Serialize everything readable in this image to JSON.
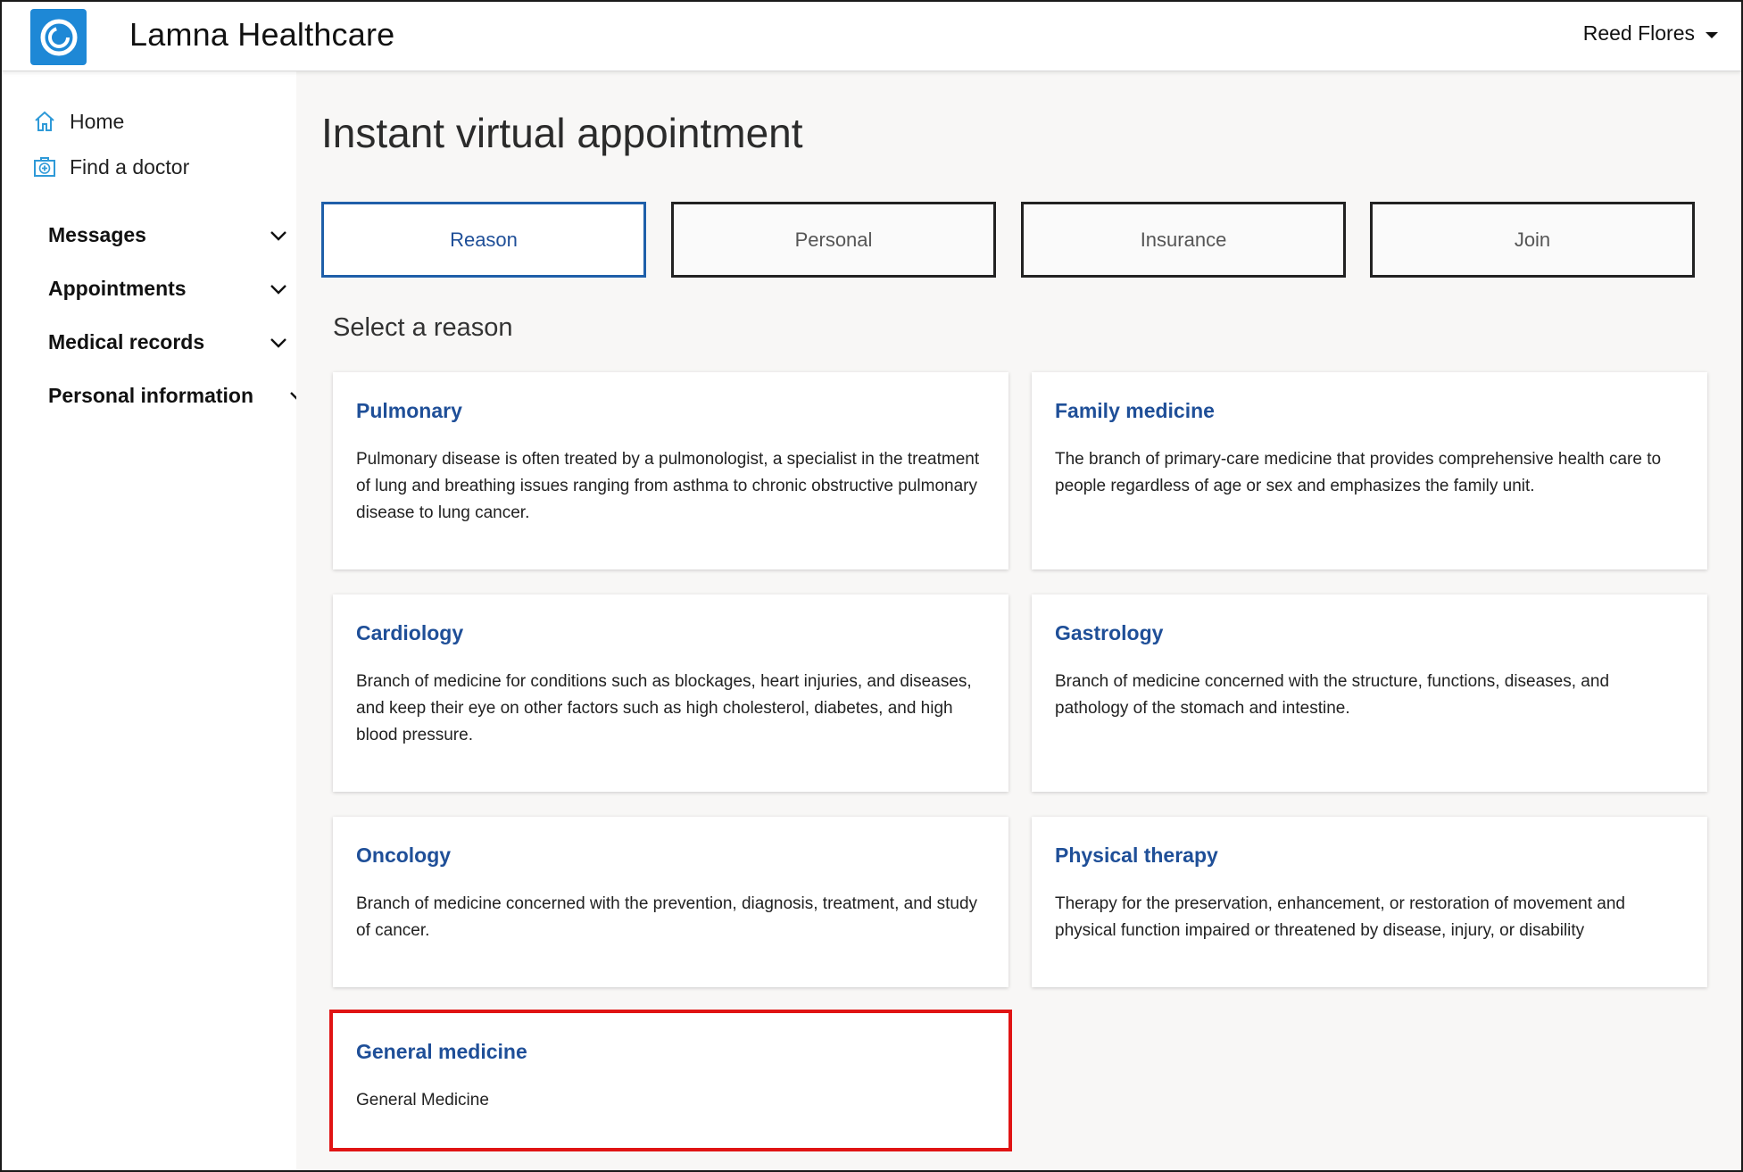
{
  "header": {
    "app_title": "Lamna Healthcare",
    "user_name": "Reed Flores",
    "logo_icon": "ring-logo-icon"
  },
  "sidebar": {
    "links": [
      {
        "label": "Home",
        "icon": "home-icon"
      },
      {
        "label": "Find a doctor",
        "icon": "medical-kit-icon"
      }
    ],
    "groups": [
      {
        "label": "Messages"
      },
      {
        "label": "Appointments"
      },
      {
        "label": "Medical records"
      },
      {
        "label": "Personal information"
      }
    ]
  },
  "main": {
    "page_title": "Instant virtual appointment",
    "steps": [
      {
        "label": "Reason",
        "active": true
      },
      {
        "label": "Personal",
        "active": false
      },
      {
        "label": "Insurance",
        "active": false
      },
      {
        "label": "Join",
        "active": false
      }
    ],
    "section_title": "Select a reason",
    "reasons": [
      {
        "title": "Pulmonary",
        "description": "Pulmonary disease is often treated by a pulmonologist, a specialist in the treatment of lung and breathing issues ranging from asthma to chronic obstructive pulmonary disease to lung cancer."
      },
      {
        "title": "Family medicine",
        "description": "The branch of primary-care medicine that provides comprehensive health care to people regardless of age or sex and emphasizes the family unit."
      },
      {
        "title": "Cardiology",
        "description": "Branch of medicine for conditions such as blockages, heart injuries, and diseases, and keep their eye on other factors such as high cholesterol, diabetes, and high blood pressure."
      },
      {
        "title": "Gastrology",
        "description": "Branch of medicine concerned with the structure, functions, diseases, and pathology of the stomach and intestine."
      },
      {
        "title": "Oncology",
        "description": "Branch of medicine concerned with the prevention, diagnosis, treatment, and study of cancer."
      },
      {
        "title": "Physical therapy",
        "description": "Therapy for the preservation, enhancement, or restoration of movement and physical function impaired or threatened by disease, injury, or disability"
      },
      {
        "title": "General medicine",
        "description": "General Medicine",
        "highlighted": true
      }
    ]
  },
  "colors": {
    "accent": "#1f4f98",
    "active_tab_border": "#1f5fa9",
    "logo_bg": "#1e88d6",
    "highlight": "#e01414",
    "main_bg": "#f8f7f6"
  }
}
